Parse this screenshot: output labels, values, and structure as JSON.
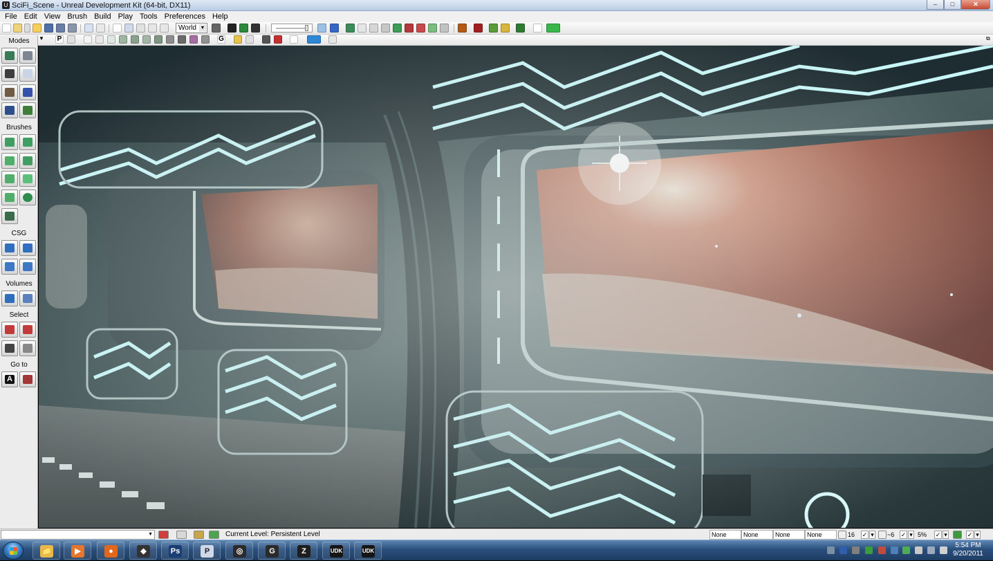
{
  "window": {
    "title": "SciFi_Scene - Unreal Development Kit (64-bit, DX11)",
    "controls": {
      "minimize": "‒",
      "maximize": "□",
      "close": "✕"
    }
  },
  "menu": {
    "items": [
      "File",
      "Edit",
      "View",
      "Brush",
      "Build",
      "Play",
      "Tools",
      "Preferences",
      "Help"
    ]
  },
  "toolbar": {
    "coordinate_system": "World",
    "viewport_toolbar_p": "P",
    "viewport_toolbar_g": "G"
  },
  "modes_panel": {
    "sections": {
      "modes": "Modes",
      "brushes": "Brushes",
      "csg": "CSG",
      "volumes": "Volumes",
      "select": "Select",
      "goto": "Go to"
    },
    "goto_builder_glyph": "A"
  },
  "viewport": {
    "scene": "sci-fi corridor with nebula windows"
  },
  "statusbar": {
    "current_level": "Current Level:  Persistent Level",
    "field1": "None",
    "field2": "None",
    "field3": "None",
    "field4": "None",
    "grid_size": "16",
    "rotation_snap": "~6",
    "scale_snap": "5%"
  },
  "taskbar": {
    "apps": [
      {
        "name": "explorer",
        "glyph": "📁",
        "color": "#e6b94a"
      },
      {
        "name": "media-player",
        "glyph": "▶",
        "color": "#e7762c"
      },
      {
        "name": "firefox",
        "glyph": "●",
        "color": "#e2671c"
      },
      {
        "name": "unity",
        "glyph": "◆",
        "color": "#333333"
      },
      {
        "name": "photoshop",
        "glyph": "Ps",
        "color": "#1b3f75"
      },
      {
        "name": "p-app",
        "glyph": "P",
        "color": "#cfd8e6"
      },
      {
        "name": "app-swirl",
        "glyph": "◎",
        "color": "#2b2b2b"
      },
      {
        "name": "app-ring",
        "glyph": "G",
        "color": "#2b2b2b"
      },
      {
        "name": "zbrush",
        "glyph": "Z",
        "color": "#1e1e1e"
      },
      {
        "name": "udk-1",
        "glyph": "UDK",
        "color": "#151515"
      },
      {
        "name": "udk-2",
        "glyph": "UDK",
        "color": "#151515"
      }
    ],
    "clock_time": "5:54 PM",
    "clock_date": "9/20/2011"
  }
}
